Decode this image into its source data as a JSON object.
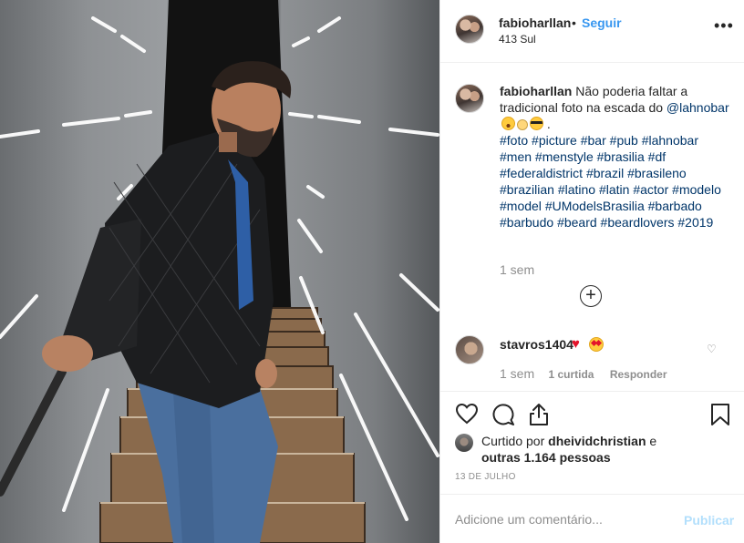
{
  "post": {
    "username": "fabioharllan",
    "separator": "•",
    "follow_label": "Seguir",
    "location": "413 Sul",
    "more_label": "•••"
  },
  "caption": {
    "username": "fabioharllan",
    "text": "Não poderia faltar a tradicional foto na escada do",
    "mention": "@lahnobar",
    "trailing": ".",
    "hashtags": [
      "#foto",
      "#picture",
      "#bar",
      "#pub",
      "#lahnobar",
      "#men",
      "#menstyle",
      "#brasilia",
      "#df",
      "#federaldistrict",
      "#brazil",
      "#brasileno",
      "#brazilian",
      "#latino",
      "#latin",
      "#actor",
      "#modelo",
      "#model",
      "#UModelsBrasilia",
      "#barbado",
      "#barbudo",
      "#beard",
      "#beardlovers",
      "#2019"
    ],
    "time": "1 sem",
    "load_more_label": "+"
  },
  "comment": {
    "username": "stavros1404",
    "emojis": [
      "heart",
      "heart-eyes"
    ],
    "time": "1 sem",
    "likes": "1 curtida",
    "reply_label": "Responder"
  },
  "likes": {
    "prefix": "Curtido por",
    "user": "dheividchristian",
    "connector": "e",
    "others": "outras 1.164 pessoas"
  },
  "date": "13 de julho",
  "add_comment": {
    "placeholder": "Adicione um comentário...",
    "publish_label": "Publicar"
  },
  "colors": {
    "link": "#003569",
    "follow": "#3897f0",
    "publish_disabled": "#b2dffc",
    "muted": "#8e8e8e",
    "heart": "#e3142b"
  }
}
